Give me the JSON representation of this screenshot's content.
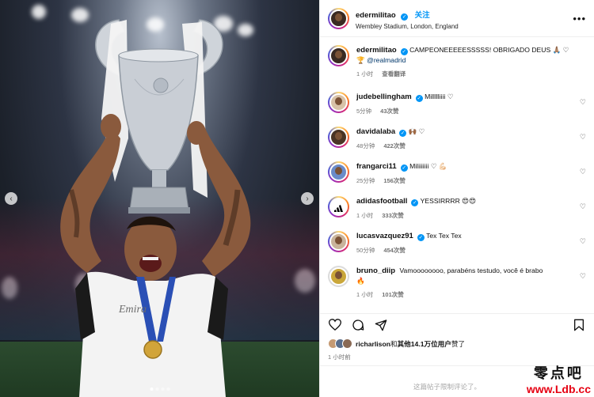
{
  "header": {
    "username": "edermilitao",
    "follow_label": "关注",
    "location": "Wembley Stadium, London, England",
    "more_icon": "more-horizontal-icon"
  },
  "caption": {
    "username": "edermilitao",
    "text": "CAMPEONEEEEESSSSS! OBRIGADO DEUS 🙏🏽 ♡",
    "line2_prefix": "🏆",
    "mention": "@realmadrid",
    "time": "1 小时",
    "translate": "查看翻译"
  },
  "comments": [
    {
      "username": "judebellingham",
      "text": "Millllliiii ♡",
      "time": "5分钟",
      "likes": "43次赞"
    },
    {
      "username": "davidalaba",
      "text": "🙌🏾 ♡",
      "time": "48分钟",
      "likes": "422次赞"
    },
    {
      "username": "frangarci11",
      "text": "Miliiiiiii ♡ 💪🏻",
      "time": "25分钟",
      "likes": "156次赞"
    },
    {
      "username": "adidasfootball",
      "text": "YESSIRRRR 😍😍",
      "time": "1 小时",
      "likes": "333次赞"
    },
    {
      "username": "lucasvazquez91",
      "text": "Tex Tex Tex",
      "time": "50分钟",
      "likes": "454次赞"
    },
    {
      "username": "bruno_diip",
      "text": "Vamoooooooo, parabéns testudo, você é brabo",
      "text_line2": "🔥",
      "time": "1 小时",
      "likes": "101次赞"
    }
  ],
  "likes": {
    "liker": "richarlison",
    "mid": "和",
    "others": "其他14.1万位用户",
    "suffix": "赞了"
  },
  "post_time": "1 小时前",
  "comments_limited": "这篇帖子限制评论了。",
  "watermark": {
    "cn": "零点吧",
    "url": "www.Ldb.cc"
  },
  "photo": {
    "nav_left": "‹",
    "nav_right": "›"
  }
}
